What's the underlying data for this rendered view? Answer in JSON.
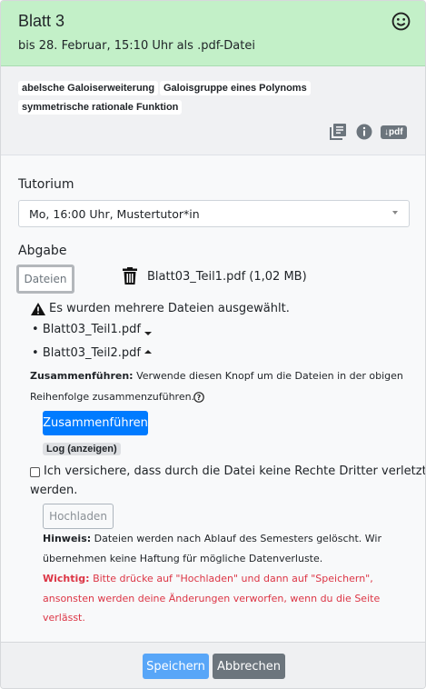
{
  "header": {
    "title": "Blatt 3",
    "subtitle": "bis 28. Februar, 15:10 Uhr als .pdf-Datei"
  },
  "tags": [
    "abelsche Galoiserweiterung",
    "Galoisgruppe eines Polynoms",
    "symmetrische rationale Funktion"
  ],
  "actions": {
    "pdf_label": "↓pdf"
  },
  "tutorium": {
    "label": "Tutorium",
    "selected": "Mo, 16:00 Uhr, Mustertutor*in"
  },
  "abgabe": {
    "label": "Abgabe",
    "files_button": "Dateien",
    "current_file": "Blatt03_Teil1.pdf (1,02 MB)",
    "warning": "Es wurden mehrere Dateien ausgewählt.",
    "files": [
      "Blatt03_Teil1.pdf",
      "Blatt03_Teil2.pdf"
    ],
    "merge_bold": "Zusammenführen:",
    "merge_text_1": "Verwende diesen Knopf um die Dateien in der obigen",
    "merge_text_2": "Reihenfolge zusammenzuführen.",
    "merge_button": "Zusammenführen",
    "log_button": "Log (anzeigen)",
    "consent_1": "Ich versichere, dass durch die Datei keine Rechte Dritter verletzt",
    "consent_2": "werden.",
    "upload_button": "Hochladen",
    "hint_bold": "Hinweis:",
    "hint_1": "Dateien werden nach Ablauf des Semesters gelöscht. Wir",
    "hint_2": "übernehmen keine Haftung für mögliche Datenverluste.",
    "important_bold": "Wichtig:",
    "important_1": "Bitte drücke auf \"Hochladen\" und dann auf \"Speichern\",",
    "important_2": "ansonsten werden deine Änderungen verworfen, wenn du die Seite",
    "important_3": "verlässt."
  },
  "footer": {
    "save": "Speichern",
    "cancel": "Abbrechen"
  }
}
